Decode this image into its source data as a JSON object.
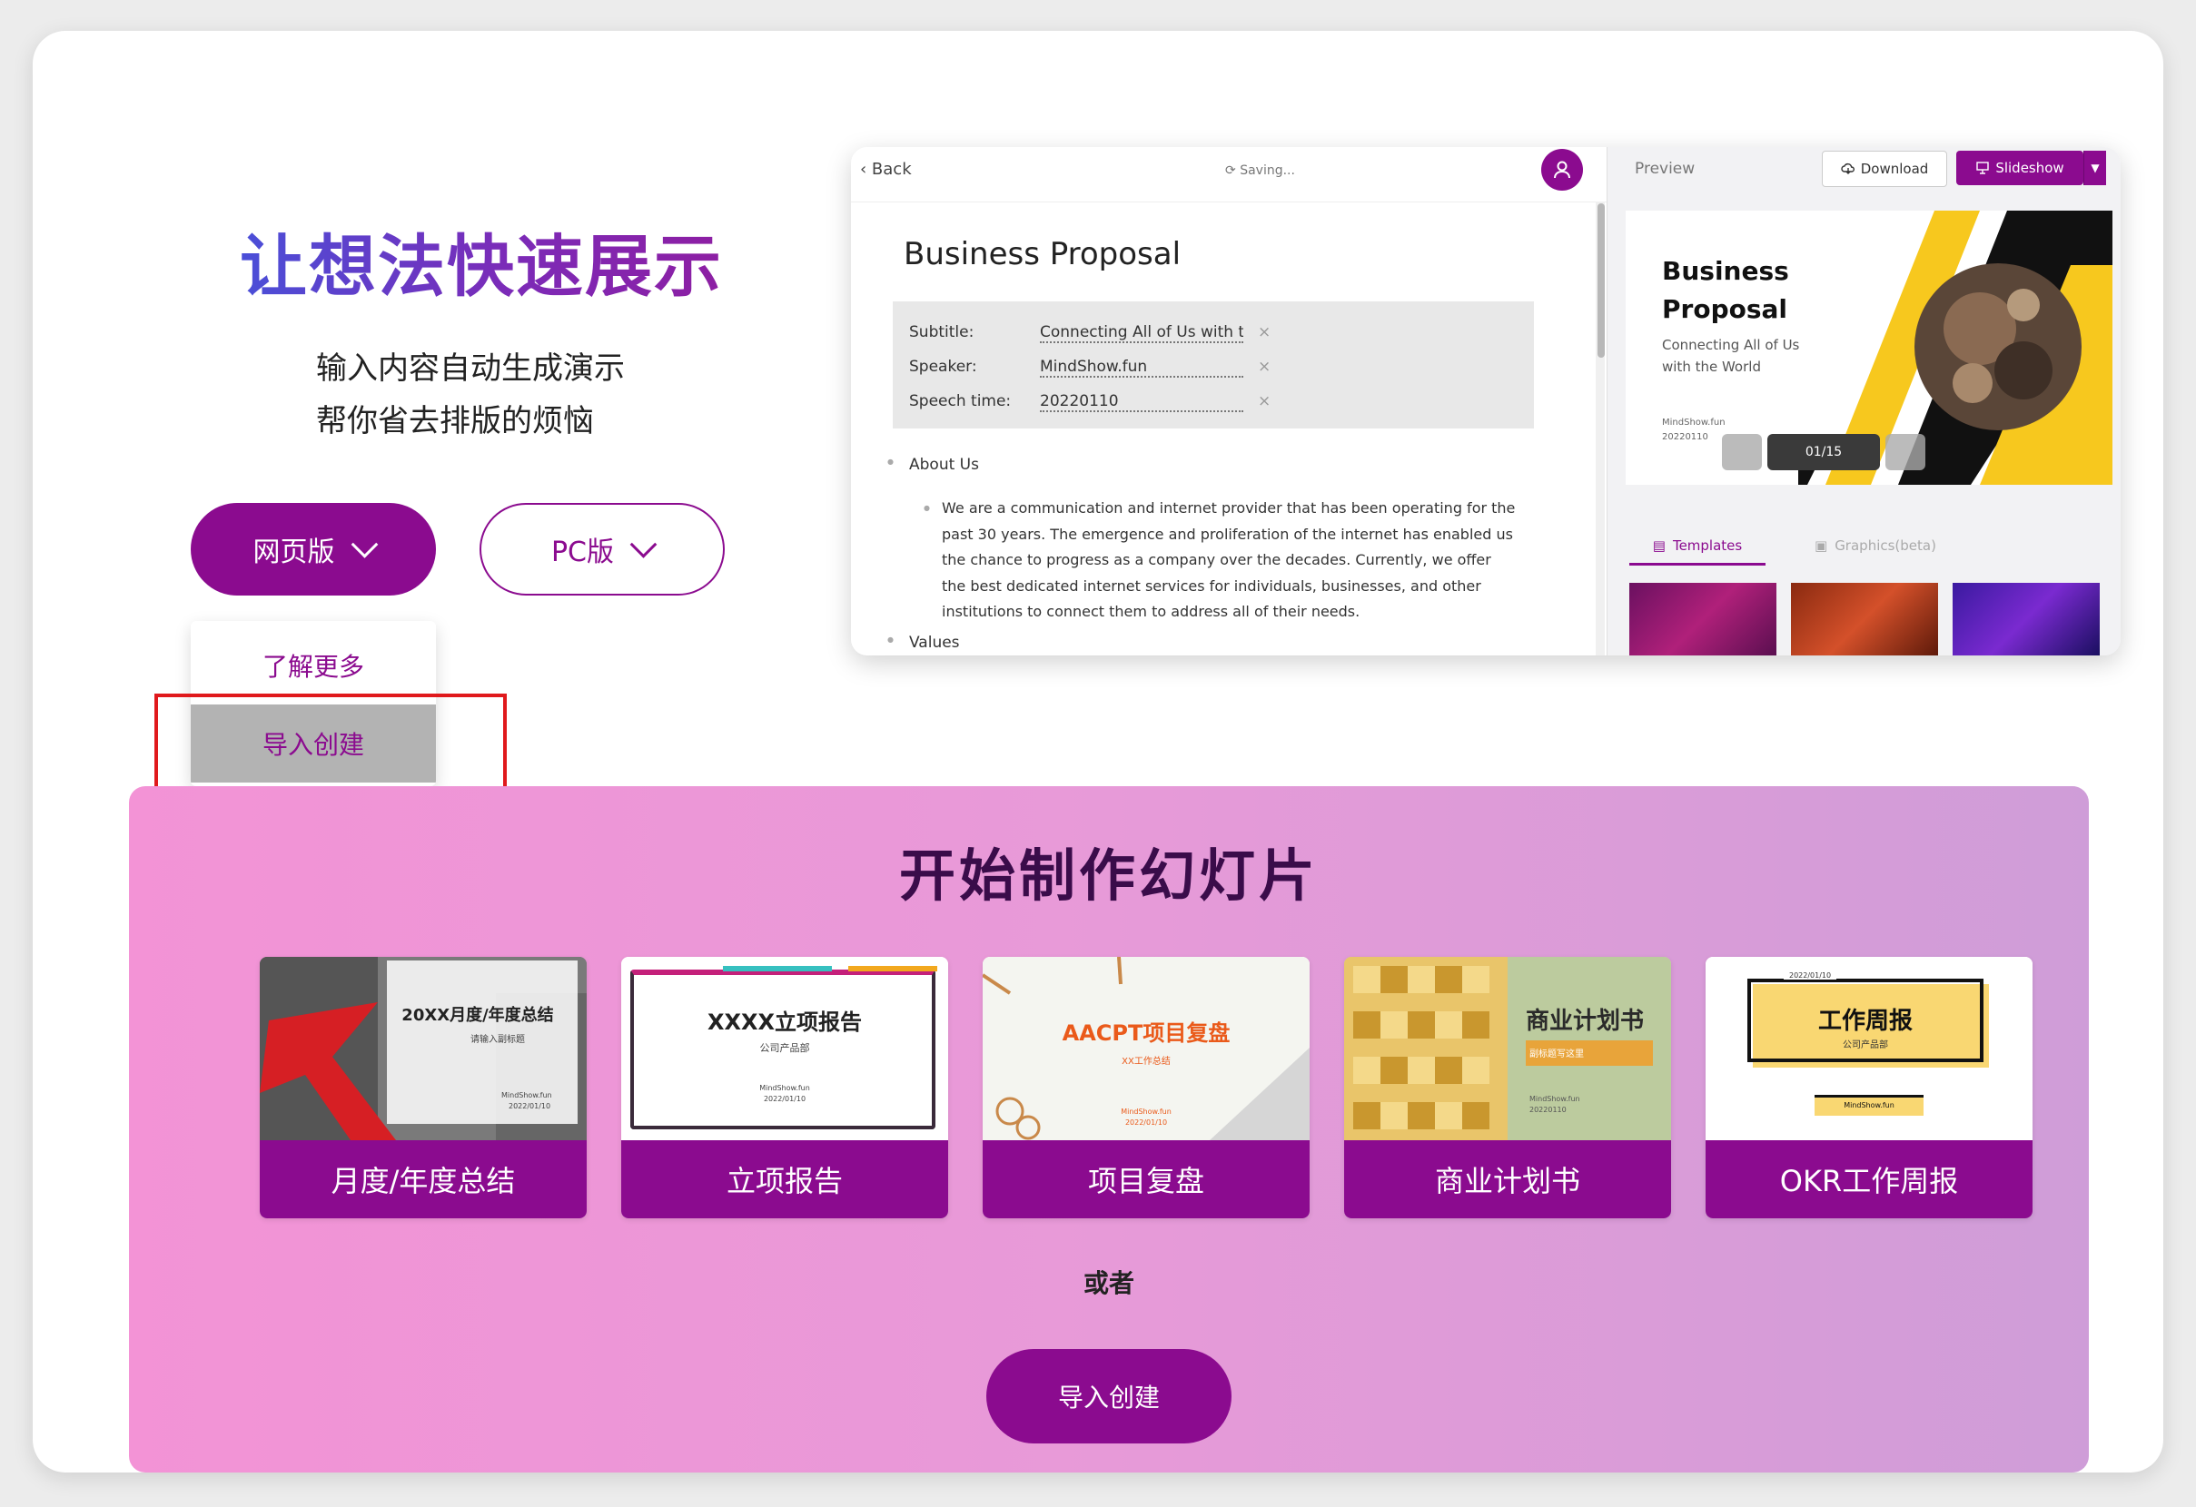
{
  "hero": {
    "title": "让想法快速展示",
    "subtitle_line1": "输入内容自动生成演示",
    "subtitle_line2": "帮你省去排版的烦恼"
  },
  "buttons": {
    "web_label": "网页版",
    "pc_label": "PC版"
  },
  "dropdown": {
    "items": [
      {
        "label": "了解更多"
      },
      {
        "label": "导入创建",
        "highlighted": true
      }
    ]
  },
  "editor": {
    "back_label": "Back",
    "saving_label": "Saving...",
    "doc_title": "Business Proposal",
    "meta": [
      {
        "key": "Subtitle:",
        "value": "Connecting All of Us with th"
      },
      {
        "key": "Speaker:",
        "value": "MindShow.fun"
      },
      {
        "key": "Speech time:",
        "value": "20220110"
      }
    ],
    "section1": "About Us",
    "paragraph": "We are a communication and internet provider that has been operating for the past 30 years. The emergence and proliferation of the internet has enabled us the chance to progress as a company over the decades. Currently, we offer the best dedicated internet services for individuals, businesses, and other institutions to connect them to address all of their needs.",
    "section2": "Values"
  },
  "preview": {
    "label": "Preview",
    "download_label": "Download",
    "slideshow_label": "Slideshow",
    "slide_title_1": "Business",
    "slide_title_2": "Proposal",
    "slide_sub_1": "Connecting All of Us",
    "slide_sub_2": "with the World",
    "slide_meta_1": "MindShow.fun",
    "slide_meta_2": "20220110",
    "page_indicator": "01/15",
    "tab_templates": "Templates",
    "tab_graphics": "Graphics(beta)"
  },
  "section": {
    "title": "开始制作幻灯片",
    "templates": [
      {
        "label": "月度/年度总结",
        "thumb_title": "20XX月度/年度总结",
        "thumb_sub": "请输入副标题",
        "thumb_meta1": "MindShow.fun",
        "thumb_meta2": "2022/01/10"
      },
      {
        "label": "立项报告",
        "thumb_title": "XXXX立项报告",
        "thumb_sub": "公司产品部",
        "thumb_meta1": "MindShow.fun",
        "thumb_meta2": "2022/01/10"
      },
      {
        "label": "项目复盘",
        "thumb_title": "AACPT项目复盘",
        "thumb_sub": "XX工作总结",
        "thumb_meta1": "MindShow.fun",
        "thumb_meta2": "2022/01/10"
      },
      {
        "label": "商业计划书",
        "thumb_title": "商业计划书",
        "thumb_sub": "副标题写这里",
        "thumb_meta1": "MindShow.fun",
        "thumb_meta2": "20220110"
      },
      {
        "label": "OKR工作周报",
        "thumb_title": "工作周报",
        "thumb_sub": "公司产品部",
        "thumb_meta1": "MindShow.fun",
        "thumb_date": "2022/01/10"
      }
    ],
    "or_label": "或者",
    "import_label": "导入创建"
  },
  "colors": {
    "brand": "#8b0b8f",
    "highlight_border": "#e0191c",
    "band_start": "#f393d6",
    "band_end": "#cf9dd8"
  }
}
